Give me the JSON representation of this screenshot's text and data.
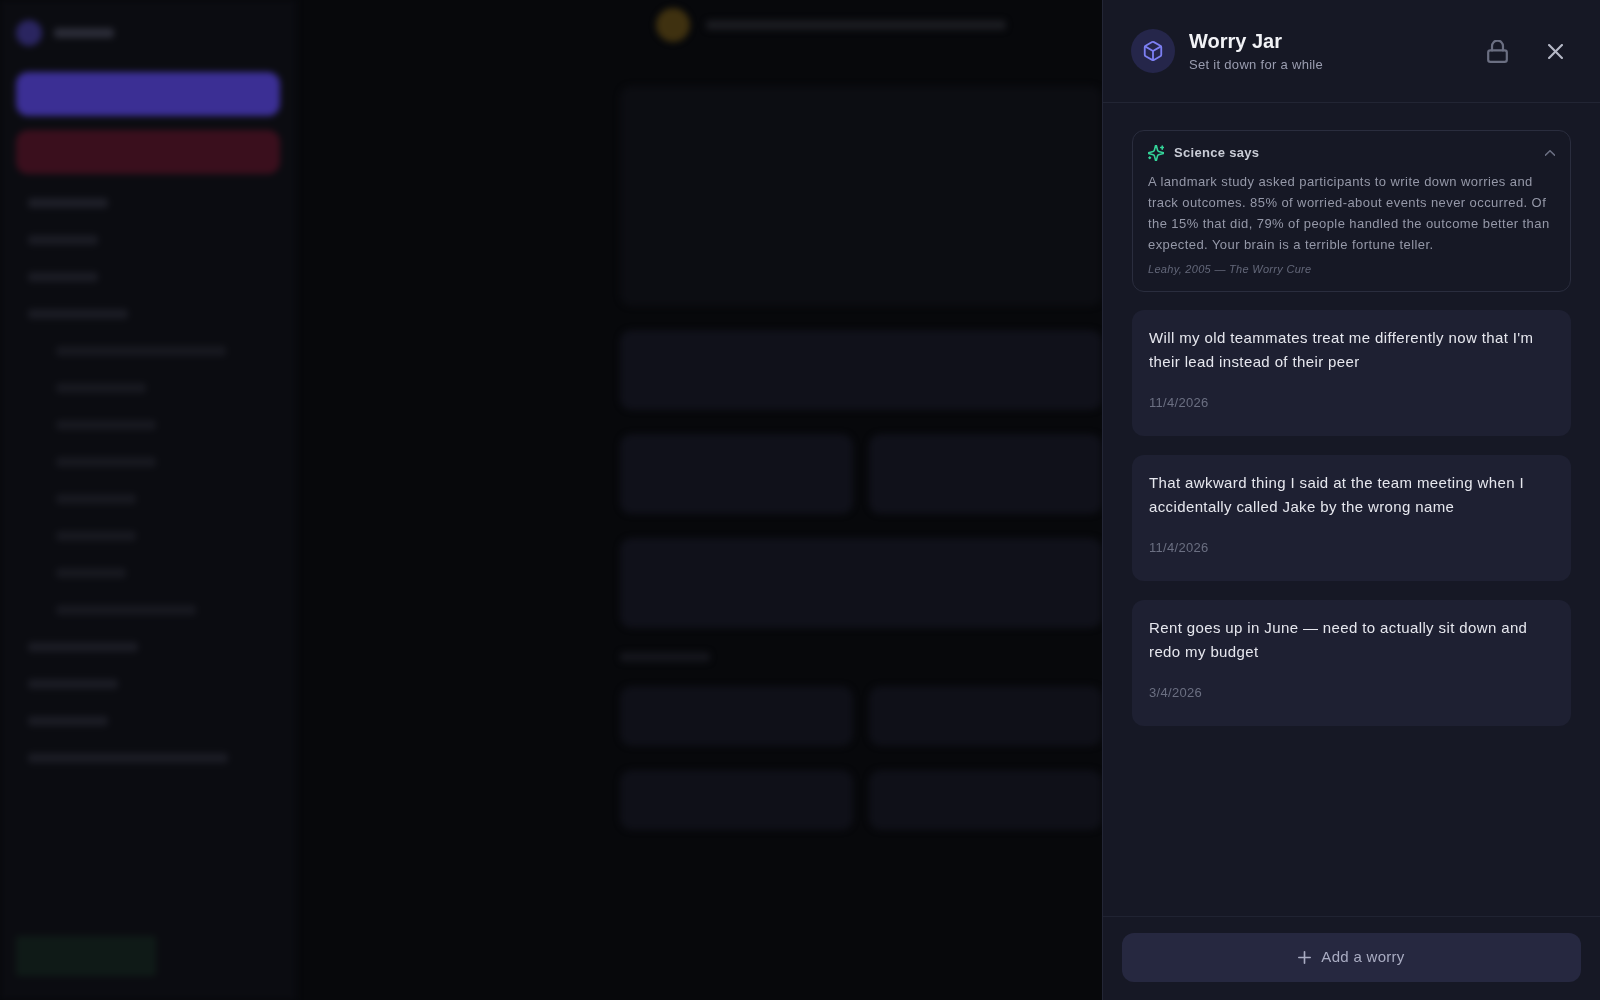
{
  "panel": {
    "title": "Worry Jar",
    "subtitle": "Set it down for a while"
  },
  "science_card": {
    "heading": "Science says",
    "expanded": true,
    "body": "A landmark study asked participants to write down worries and track outcomes. 85% of worried-about events never occurred. Of the 15% that did, 79% of people handled the outcome better than expected. Your brain is a terrible fortune teller.",
    "citation": "Leahy, 2005 — The Worry Cure"
  },
  "worries": [
    {
      "text": "Will my old teammates treat me differently now that I'm their lead instead of their peer",
      "date": "11/4/2026"
    },
    {
      "text": "That awkward thing I said at the team meeting when I accidentally called Jake by the wrong name",
      "date": "11/4/2026"
    },
    {
      "text": "Rent goes up in June — need to actually sit down and redo my budget",
      "date": "3/4/2026"
    }
  ],
  "add_button": {
    "label": "Add a worry"
  }
}
